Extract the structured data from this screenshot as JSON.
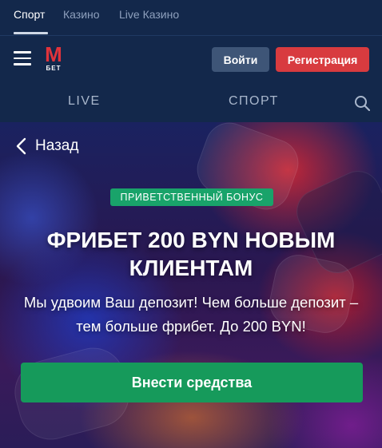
{
  "top_tabs": [
    {
      "label": "Спорт",
      "active": true
    },
    {
      "label": "Казино",
      "active": false
    },
    {
      "label": "Live Казино",
      "active": false
    }
  ],
  "header": {
    "logo_letter": "М",
    "logo_sub": "БЕТ",
    "login_label": "Войти",
    "register_label": "Регистрация"
  },
  "nav": {
    "live_label": "LIVE",
    "sport_label": "СПОРТ",
    "search_icon": "search-icon"
  },
  "banner": {
    "back_label": "Назад",
    "badge": "ПРИВЕТСТВЕННЫЙ БОНУС",
    "headline": "ФРИБЕТ 200 BYN НОВЫМ КЛИЕНТАМ",
    "subtitle": "Мы удвоим Ваш депозит! Чем больше депозит – тем больше фрибет. До 200 BYN!",
    "cta_label": "Внести средства"
  },
  "colors": {
    "header_bg": "#13284b",
    "brand_red": "#e2333b",
    "register_red": "#d83b3f",
    "login_gray": "#3e5577",
    "badge_green": "#19a36a",
    "cta_green": "#169a5b"
  }
}
